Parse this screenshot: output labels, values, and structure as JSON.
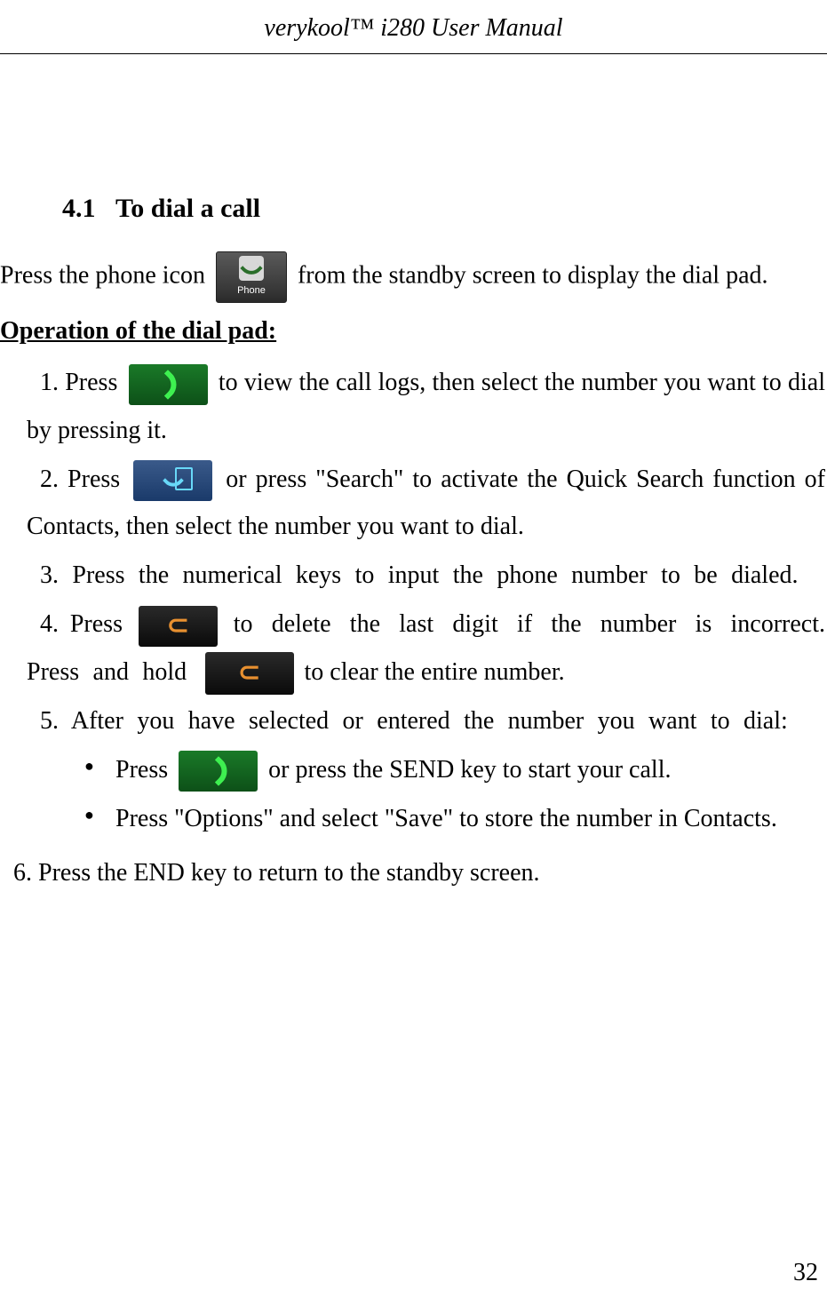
{
  "header": {
    "title": "verykool™ i280 User Manual"
  },
  "section": {
    "number": "4.1",
    "title": "To dial a call"
  },
  "phoneIconLabel": "Phone",
  "intro": {
    "part1": "Press the phone icon ",
    "part2": " from the standby screen to display the dial pad."
  },
  "operationHeading": "Operation of the dial pad:  ",
  "items": {
    "item1": {
      "prefix": "1. Press ",
      "suffix": " to view the call logs, then select the number you want to dial by pressing it."
    },
    "item2": {
      "prefix": "2. Press ",
      "suffix": " or press \"Search\" to activate the Quick Search function of Contacts, then select the number you want to dial."
    },
    "item3": "3. Press the numerical keys to input the phone number to be dialed.",
    "item4": {
      "prefix": "4. Press ",
      "mid": " to delete the last digit if the number is incorrect. Press and hold ",
      "suffix": " to clear the entire number."
    },
    "item5": "5. After you have selected or entered the number you want to dial:",
    "bullet1": {
      "prefix": "Press ",
      "suffix": " or press the SEND key to start your call."
    },
    "bullet2": "Press \"Options\" and select \"Save\" to store the number in Contacts.",
    "item6": "6.  Press the END key to return to the standby screen."
  },
  "pageNumber": "32"
}
